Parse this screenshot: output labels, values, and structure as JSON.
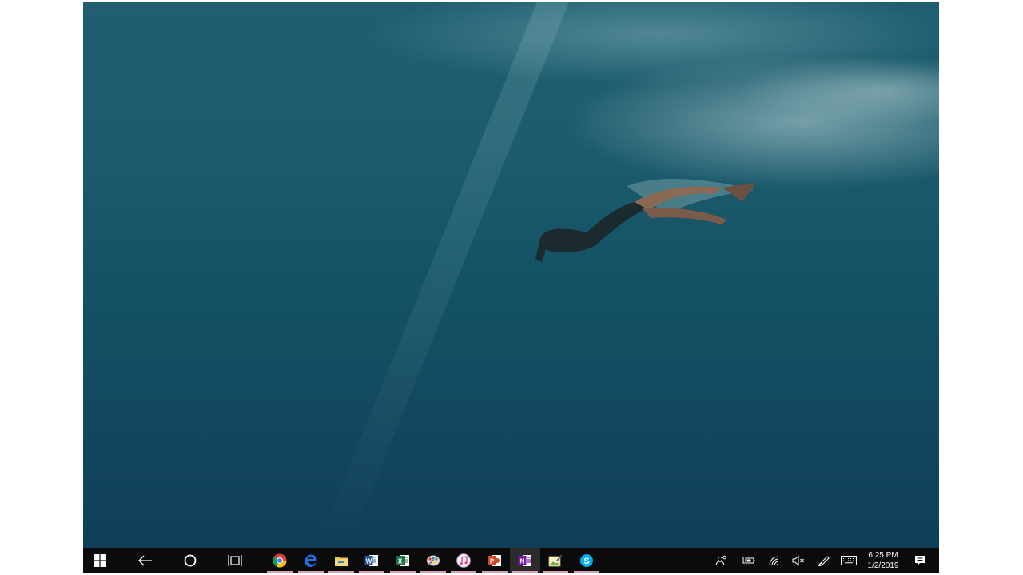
{
  "desktop": {
    "wallpaper": "underwater-freediver"
  },
  "taskbar": {
    "system_buttons": [
      {
        "name": "start-button",
        "icon": "windows-logo-icon"
      },
      {
        "name": "back-button",
        "icon": "back-arrow-icon"
      },
      {
        "name": "cortana-button",
        "icon": "cortana-circle-icon"
      },
      {
        "name": "task-view-button",
        "icon": "task-view-icon"
      }
    ],
    "pinned_apps": [
      {
        "name": "chrome",
        "icon": "chrome-icon",
        "color": "#db4437",
        "running": true
      },
      {
        "name": "edge",
        "icon": "edge-icon",
        "color": "#1a73e8",
        "running": true
      },
      {
        "name": "file-explorer",
        "icon": "folder-icon",
        "color": "#f5c242",
        "running": true
      },
      {
        "name": "word",
        "icon": "word-icon",
        "color": "#2b579a",
        "running": true
      },
      {
        "name": "excel",
        "icon": "excel-icon",
        "color": "#217346",
        "running": true
      },
      {
        "name": "paint",
        "icon": "paint-palette-icon",
        "color": "#5a6b8c",
        "running": true
      },
      {
        "name": "itunes",
        "icon": "itunes-icon",
        "color": "#e6e6f0",
        "running": true
      },
      {
        "name": "powerpoint",
        "icon": "powerpoint-icon",
        "color": "#d24726",
        "running": true
      },
      {
        "name": "onenote",
        "icon": "onenote-icon",
        "color": "#7719aa",
        "running": true,
        "active": true
      },
      {
        "name": "image-editor",
        "icon": "image-editor-icon",
        "color": "#6aa84f",
        "running": true
      },
      {
        "name": "skype",
        "icon": "skype-icon",
        "color": "#00aff0",
        "running": true
      }
    ],
    "tray_icons": [
      {
        "name": "people-icon"
      },
      {
        "name": "battery-icon"
      },
      {
        "name": "wifi-icon"
      },
      {
        "name": "volume-muted-icon"
      },
      {
        "name": "pen-icon"
      },
      {
        "name": "keyboard-icon"
      }
    ],
    "clock": {
      "time": "6:25 PM",
      "date": "1/2/2019"
    },
    "notifications": {
      "icon": "action-center-icon"
    }
  }
}
